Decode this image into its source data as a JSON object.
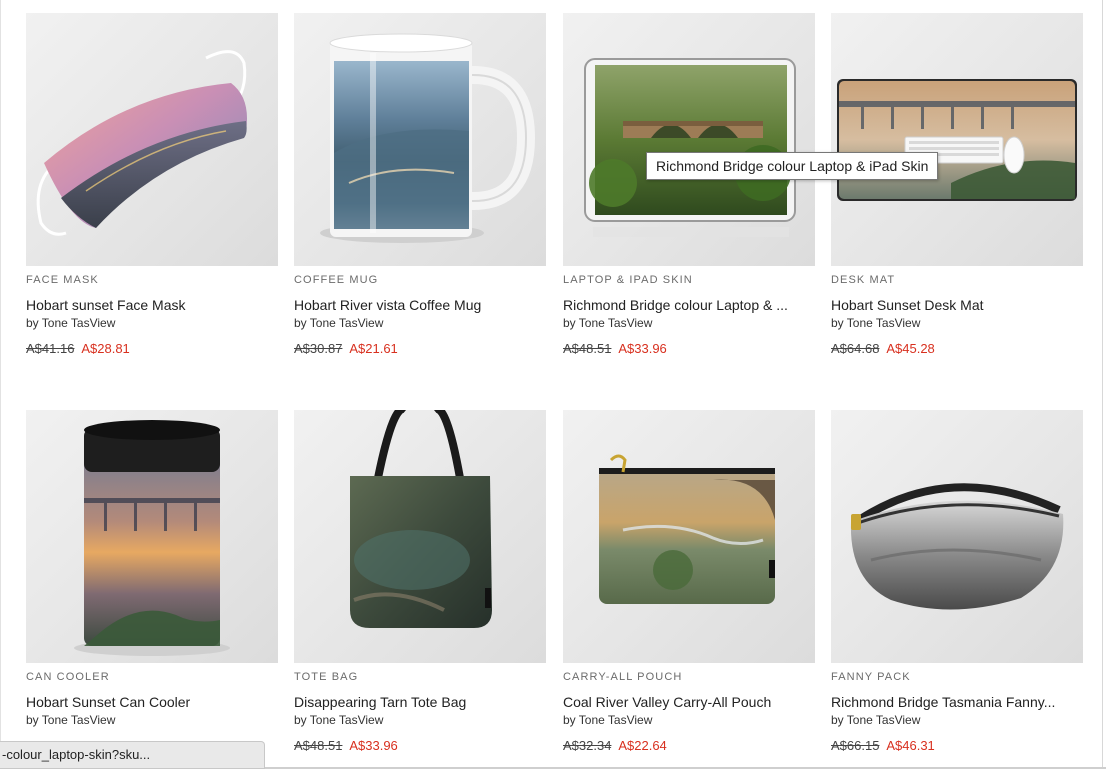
{
  "products": [
    {
      "category": "FACE MASK",
      "title": "Hobart sunset Face Mask",
      "byline": "by Tone TasView",
      "old_price": "A$41.16",
      "new_price": "A$28.81",
      "icon": "face-mask-image"
    },
    {
      "category": "COFFEE MUG",
      "title": "Hobart River vista Coffee Mug",
      "byline": "by Tone TasView",
      "old_price": "A$30.87",
      "new_price": "A$21.61",
      "icon": "coffee-mug-image"
    },
    {
      "category": "LAPTOP & IPAD SKIN",
      "title": "Richmond Bridge colour Laptop & ...",
      "byline": "by Tone TasView",
      "old_price": "A$48.51",
      "new_price": "A$33.96",
      "icon": "ipad-skin-image"
    },
    {
      "category": "DESK MAT",
      "title": "Hobart Sunset Desk Mat",
      "byline": "by Tone TasView",
      "old_price": "A$64.68",
      "new_price": "A$45.28",
      "icon": "desk-mat-image"
    },
    {
      "category": "CAN COOLER",
      "title": "Hobart Sunset Can Cooler",
      "byline": "by Tone TasView",
      "old_price": "",
      "new_price": "",
      "icon": "can-cooler-image"
    },
    {
      "category": "TOTE BAG",
      "title": "Disappearing Tarn Tote Bag",
      "byline": "by Tone TasView",
      "old_price": "A$48.51",
      "new_price": "A$33.96",
      "icon": "tote-bag-image"
    },
    {
      "category": "CARRY-ALL POUCH",
      "title": "Coal River Valley Carry-All Pouch",
      "byline": "by Tone TasView",
      "old_price": "A$32.34",
      "new_price": "A$22.64",
      "icon": "pouch-image"
    },
    {
      "category": "FANNY PACK",
      "title": "Richmond Bridge Tasmania Fanny...",
      "byline": "by Tone TasView",
      "old_price": "A$66.15",
      "new_price": "A$46.31",
      "icon": "fanny-pack-image"
    }
  ],
  "tooltip": {
    "text": "Richmond Bridge colour Laptop & iPad Skin"
  },
  "status_bar": {
    "url": "-colour_laptop-skin?sku..."
  },
  "colors": {
    "sale_price": "#d8301f",
    "category_text": "#6b6b6b"
  }
}
